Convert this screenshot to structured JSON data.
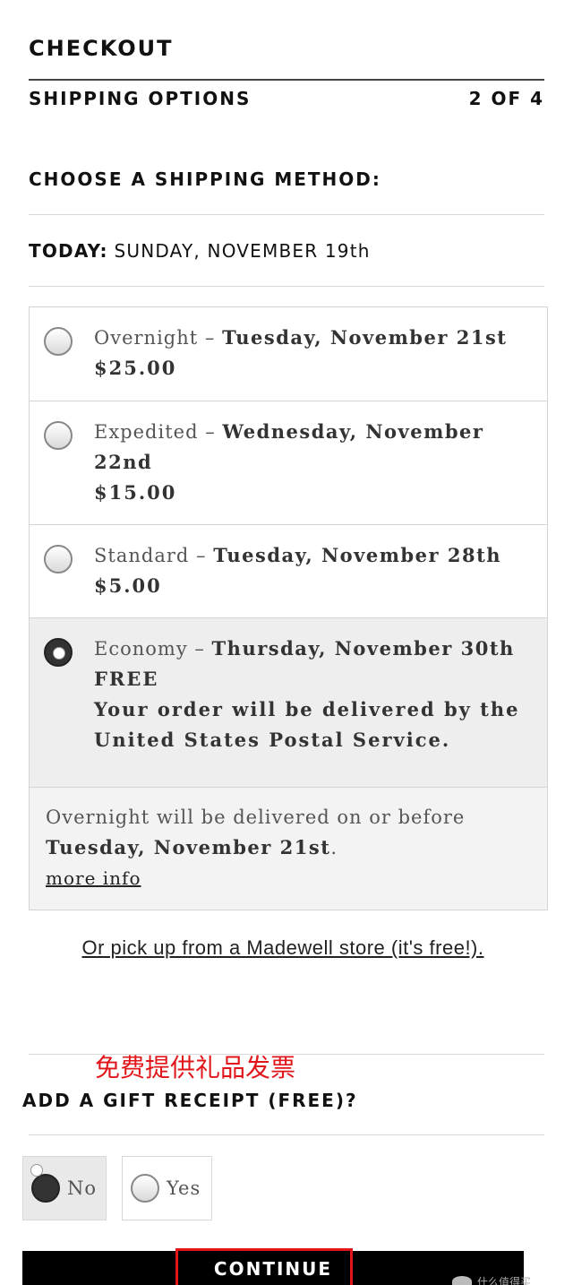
{
  "header": {
    "title": "CHECKOUT",
    "section": "SHIPPING OPTIONS",
    "step": "2 OF 4"
  },
  "shipping": {
    "heading": "CHOOSE A SHIPPING METHOD:",
    "today_label": "TODAY:",
    "today_value": "SUNDAY, NOVEMBER 19th",
    "options": [
      {
        "name": "Overnight",
        "sep": " – ",
        "date": "Tuesday, November 21st",
        "price": "$25.00",
        "selected": false
      },
      {
        "name": "Expedited",
        "sep": " – ",
        "date": "Wednesday, November 22nd",
        "price": "$15.00",
        "selected": false
      },
      {
        "name": "Standard",
        "sep": " – ",
        "date": "Tuesday, November 28th",
        "price": "$5.00",
        "selected": false
      },
      {
        "name": "Economy",
        "sep": " – ",
        "date": "Thursday, November 30th",
        "price": "FREE",
        "note": "Your order will be delivered by the United States Postal Service.",
        "selected": true
      }
    ],
    "info_text": "Overnight will be delivered on or before",
    "info_date": "Tuesday, November 21st",
    "info_period": ".",
    "more_info": "more info",
    "pickup_link": "Or pick up from a Madewell store (it's free!)."
  },
  "annotation": {
    "cn_note": "免费提供礼品发票",
    "highlight_color": "#e0161b"
  },
  "gift_receipt": {
    "heading": "ADD A GIFT RECEIPT (FREE)?",
    "no_label": "No",
    "yes_label": "Yes",
    "selected": "No"
  },
  "actions": {
    "continue_label": "CONTINUE"
  },
  "watermark": {
    "text": "什么值得买"
  }
}
